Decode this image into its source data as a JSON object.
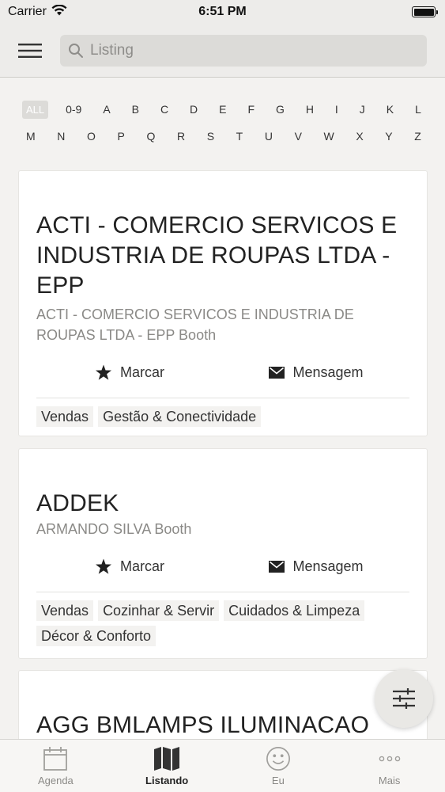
{
  "status_bar": {
    "carrier": "Carrier",
    "time": "6:51 PM"
  },
  "header": {
    "search_placeholder": "Listing"
  },
  "alphabet": {
    "row1": [
      "ALL",
      "0-9",
      "A",
      "B",
      "C",
      "D",
      "E",
      "F",
      "G",
      "H",
      "I",
      "J",
      "K",
      "L"
    ],
    "row2": [
      "M",
      "N",
      "O",
      "P",
      "Q",
      "R",
      "S",
      "T",
      "U",
      "V",
      "W",
      "X",
      "Y",
      "Z"
    ],
    "selected": "ALL"
  },
  "cards": [
    {
      "title": "ACTI - COMERCIO SERVICOS E INDUSTRIA DE ROUPAS LTDA - EPP",
      "subtitle": "ACTI - COMERCIO SERVICOS E INDUSTRIA DE ROUPAS LTDA - EPP Booth",
      "mark_label": "Marcar",
      "message_label": "Mensagem",
      "tags": [
        "Vendas",
        "Gestão & Conectividade"
      ]
    },
    {
      "title": "ADDEK",
      "subtitle": "ARMANDO SILVA Booth",
      "mark_label": "Marcar",
      "message_label": "Mensagem",
      "tags": [
        "Vendas",
        "Cozinhar & Servir",
        "Cuidados & Limpeza",
        "Décor & Conforto"
      ]
    },
    {
      "title": "AGG BMLAMPS ILUMINACAO"
    }
  ],
  "tabbar": {
    "tabs": [
      {
        "label": "Agenda",
        "icon": "calendar-icon"
      },
      {
        "label": "Listando",
        "icon": "map-icon",
        "active": true
      },
      {
        "label": "Eu",
        "icon": "smiley-icon"
      },
      {
        "label": "Mais",
        "icon": "more-icon"
      }
    ]
  },
  "colors": {
    "background": "#f3f2f0",
    "card": "#ffffff",
    "tag_bg": "#f3f2f0",
    "text": "#222222",
    "muted": "#8a8986"
  }
}
